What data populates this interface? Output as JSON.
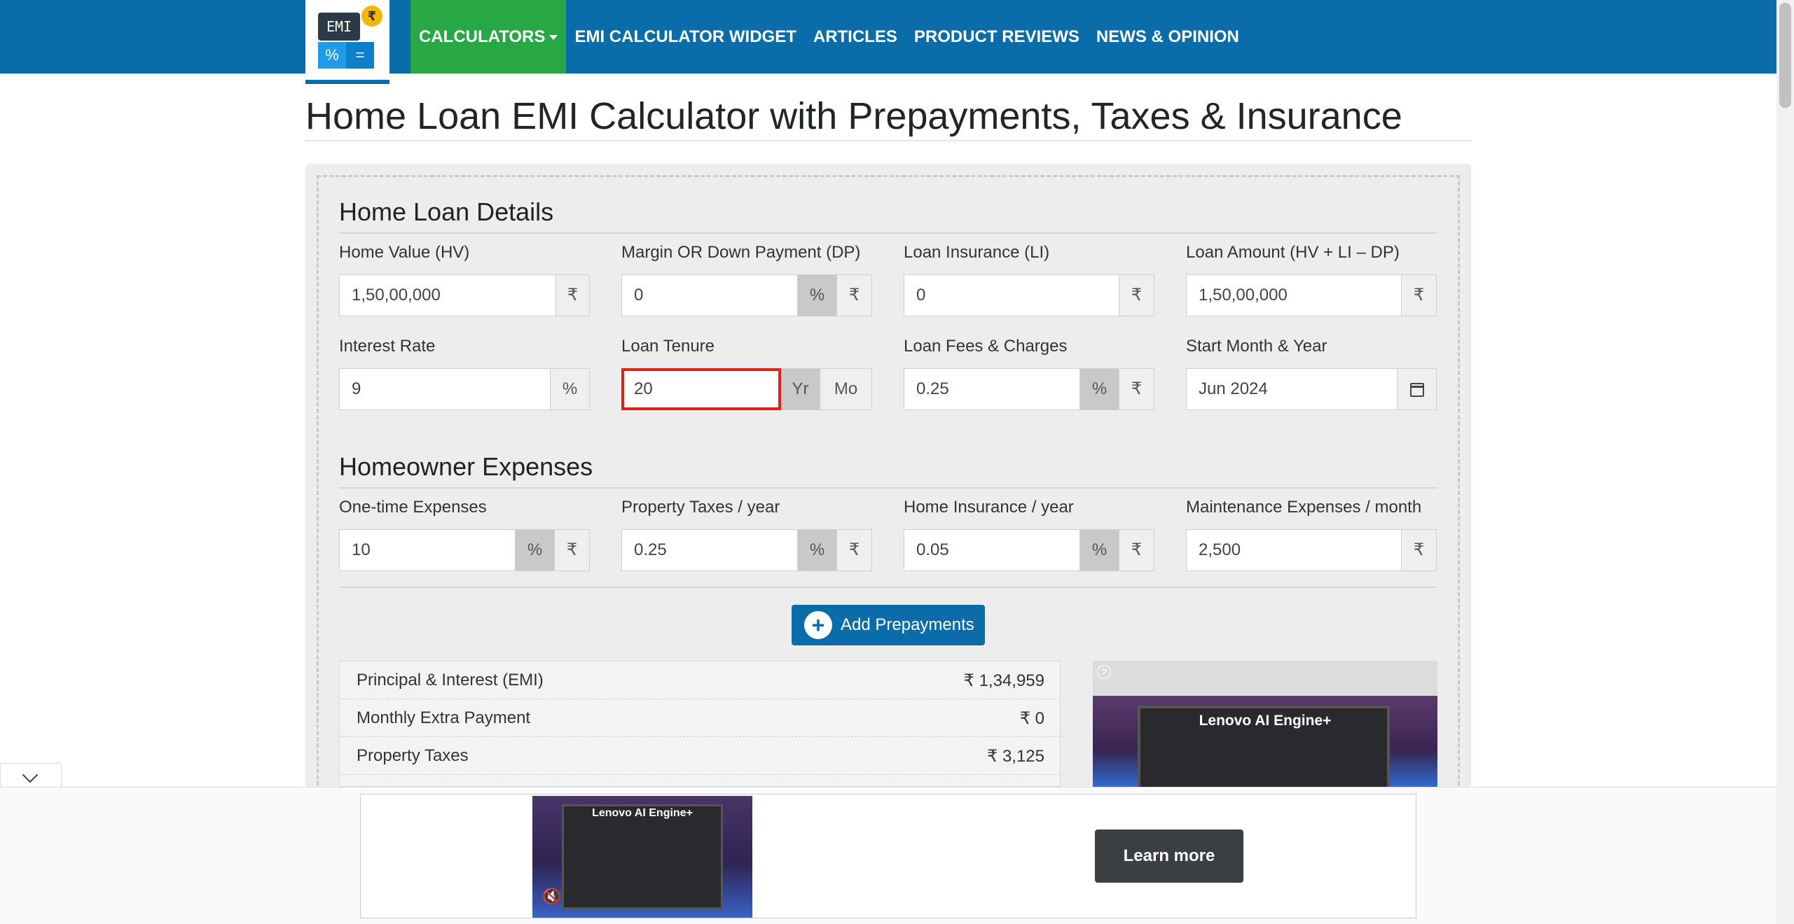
{
  "logo": {
    "screen": "EMI",
    "coin": "₹",
    "key_pct": "%",
    "key_eq": "="
  },
  "nav": {
    "items": [
      "CALCULATORS",
      "EMI CALCULATOR WIDGET",
      "ARTICLES",
      "PRODUCT REVIEWS",
      "NEWS & OPINION"
    ],
    "active_index": 0
  },
  "page_title": "Home Loan EMI Calculator with Prepayments, Taxes & Insurance",
  "loan_details": {
    "title": "Home Loan Details",
    "home_value": {
      "label": "Home Value (HV)",
      "value": "1,50,00,000",
      "unit": "₹"
    },
    "down_payment": {
      "label": "Margin OR Down Payment (DP)",
      "value": "0",
      "unit_pct": "%",
      "unit_rs": "₹"
    },
    "loan_insurance": {
      "label": "Loan Insurance (LI)",
      "value": "0",
      "unit": "₹"
    },
    "loan_amount": {
      "label": "Loan Amount (HV + LI – DP)",
      "value": "1,50,00,000",
      "unit": "₹"
    },
    "interest_rate": {
      "label": "Interest Rate",
      "value": "9",
      "unit": "%"
    },
    "loan_tenure": {
      "label": "Loan Tenure",
      "value": "20",
      "unit_yr": "Yr",
      "unit_mo": "Mo"
    },
    "loan_fees": {
      "label": "Loan Fees & Charges",
      "value": "0.25",
      "unit_pct": "%",
      "unit_rs": "₹"
    },
    "start_month": {
      "label": "Start Month & Year",
      "value": "Jun 2024"
    }
  },
  "homeowner": {
    "title": "Homeowner Expenses",
    "one_time": {
      "label": "One-time Expenses",
      "value": "10",
      "unit_pct": "%",
      "unit_rs": "₹"
    },
    "property_taxes": {
      "label": "Property Taxes / year",
      "value": "0.25",
      "unit_pct": "%",
      "unit_rs": "₹"
    },
    "home_insurance": {
      "label": "Home Insurance / year",
      "value": "0.05",
      "unit_pct": "%",
      "unit_rs": "₹"
    },
    "maintenance": {
      "label": "Maintenance Expenses / month",
      "value": "2,500",
      "unit": "₹"
    }
  },
  "add_prepayments": "Add Prepayments",
  "summary": [
    {
      "label": "Principal & Interest (EMI)",
      "value": "₹ 1,34,959"
    },
    {
      "label": "Monthly Extra Payment",
      "value": "₹ 0"
    },
    {
      "label": "Property Taxes",
      "value": "₹ 3,125"
    }
  ],
  "side_ad": {
    "brand": "Lenovo AI Engine+",
    "help": "?"
  },
  "bottom_ad": {
    "brand": "Lenovo AI Engine+",
    "cta": "Learn more"
  },
  "colors": {
    "nav_bg": "#0a6ca8",
    "active_nav": "#28a745",
    "focus_border": "#e0221c"
  }
}
